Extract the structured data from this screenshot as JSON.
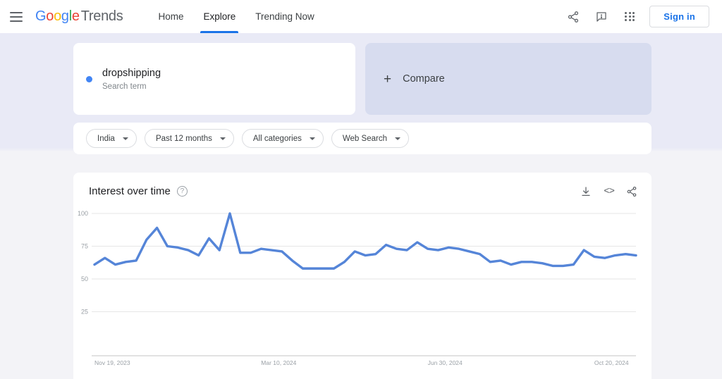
{
  "header": {
    "menu_icon": "hamburger-icon",
    "brand": {
      "g1": "G",
      "o1": "o",
      "o2": "o",
      "g2": "g",
      "l": "l",
      "e": "e",
      "trends": "Trends"
    },
    "nav": [
      {
        "label": "Home",
        "active": false
      },
      {
        "label": "Explore",
        "active": true
      },
      {
        "label": "Trending Now",
        "active": false
      }
    ],
    "icons": [
      "share-icon",
      "feedback-icon",
      "apps-grid-icon"
    ],
    "sign_in_label": "Sign in"
  },
  "search_term": {
    "term": "dropshipping",
    "type_label": "Search term",
    "dot_color": "#4285F4"
  },
  "compare": {
    "label": "Compare",
    "plus": "+"
  },
  "filters": [
    {
      "label": "India"
    },
    {
      "label": "Past 12 months"
    },
    {
      "label": "All categories"
    },
    {
      "label": "Web Search"
    }
  ],
  "chart_card": {
    "title": "Interest over time",
    "help": "?",
    "actions": [
      "download-icon",
      "embed-icon",
      "share-icon"
    ],
    "embed_glyph": "<>"
  },
  "chart_data": {
    "type": "line",
    "title": "Interest over time",
    "xlabel": "",
    "ylabel": "",
    "ylim": [
      0,
      100
    ],
    "yticks": [
      25,
      50,
      75,
      100
    ],
    "grid": true,
    "legend": false,
    "line_color": "#5585D8",
    "x_tick_labels": [
      "Nov 19, 2023",
      "Mar 10, 2024",
      "Jun 30, 2024",
      "Oct 20, 2024"
    ],
    "x_tick_positions": [
      0,
      16,
      32,
      48
    ],
    "x": [
      "Nov 19, 2023",
      "Nov 26, 2023",
      "Dec 3, 2023",
      "Dec 10, 2023",
      "Dec 17, 2023",
      "Dec 24, 2023",
      "Dec 31, 2023",
      "Jan 7, 2024",
      "Jan 14, 2024",
      "Jan 21, 2024",
      "Jan 28, 2024",
      "Feb 4, 2024",
      "Feb 11, 2024",
      "Feb 18, 2024",
      "Feb 25, 2024",
      "Mar 3, 2024",
      "Mar 10, 2024",
      "Mar 17, 2024",
      "Mar 24, 2024",
      "Mar 31, 2024",
      "Apr 7, 2024",
      "Apr 14, 2024",
      "Apr 21, 2024",
      "Apr 28, 2024",
      "May 5, 2024",
      "May 12, 2024",
      "May 19, 2024",
      "May 26, 2024",
      "Jun 2, 2024",
      "Jun 9, 2024",
      "Jun 16, 2024",
      "Jun 23, 2024",
      "Jun 30, 2024",
      "Jul 7, 2024",
      "Jul 14, 2024",
      "Jul 21, 2024",
      "Jul 28, 2024",
      "Aug 4, 2024",
      "Aug 11, 2024",
      "Aug 18, 2024",
      "Aug 25, 2024",
      "Sep 1, 2024",
      "Sep 8, 2024",
      "Sep 15, 2024",
      "Sep 22, 2024",
      "Sep 29, 2024",
      "Oct 6, 2024",
      "Oct 13, 2024",
      "Oct 20, 2024",
      "Oct 27, 2024",
      "Nov 3, 2024",
      "Nov 10, 2024",
      "Nov 17, 2024"
    ],
    "values": [
      61,
      66,
      61,
      63,
      64,
      80,
      89,
      75,
      74,
      72,
      68,
      81,
      72,
      100,
      70,
      70,
      73,
      72,
      71,
      64,
      58,
      58,
      58,
      58,
      63,
      71,
      68,
      69,
      76,
      73,
      72,
      78,
      73,
      72,
      74,
      73,
      71,
      69,
      63,
      64,
      61,
      63,
      63,
      62,
      60,
      60,
      61,
      72,
      67,
      66,
      68,
      69,
      68
    ],
    "series": [
      {
        "name": "dropshipping",
        "values": [
          61,
          66,
          61,
          63,
          64,
          80,
          89,
          75,
          74,
          72,
          68,
          81,
          72,
          100,
          70,
          70,
          73,
          72,
          71,
          64,
          58,
          58,
          58,
          58,
          63,
          71,
          68,
          69,
          76,
          73,
          72,
          78,
          73,
          72,
          74,
          73,
          71,
          69,
          63,
          64,
          61,
          63,
          63,
          62,
          60,
          60,
          61,
          72,
          67,
          66,
          68,
          69,
          68
        ]
      }
    ]
  }
}
